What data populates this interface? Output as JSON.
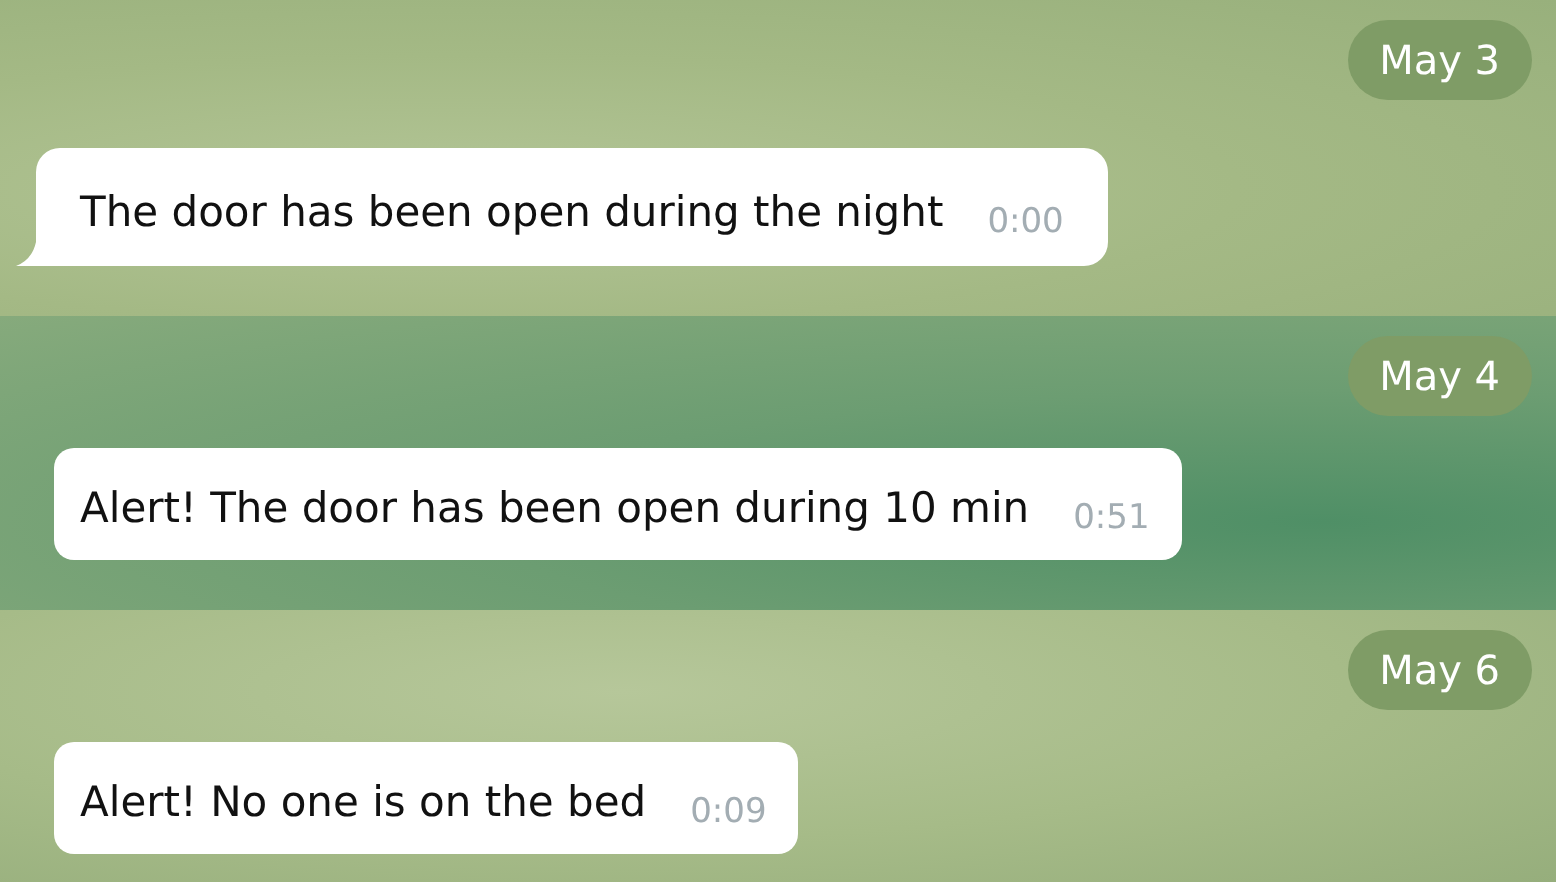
{
  "sections": [
    {
      "date": "May 3",
      "tail": true,
      "message": {
        "text": "The door has been open during the night",
        "time": "0:00"
      }
    },
    {
      "date": "May 4",
      "tail": false,
      "message": {
        "text": "Alert! The door has been open during 10 min",
        "time": "0:51"
      }
    },
    {
      "date": "May 6",
      "tail": false,
      "message": {
        "text": "Alert! No one is on the bed",
        "time": "0:09"
      }
    }
  ]
}
